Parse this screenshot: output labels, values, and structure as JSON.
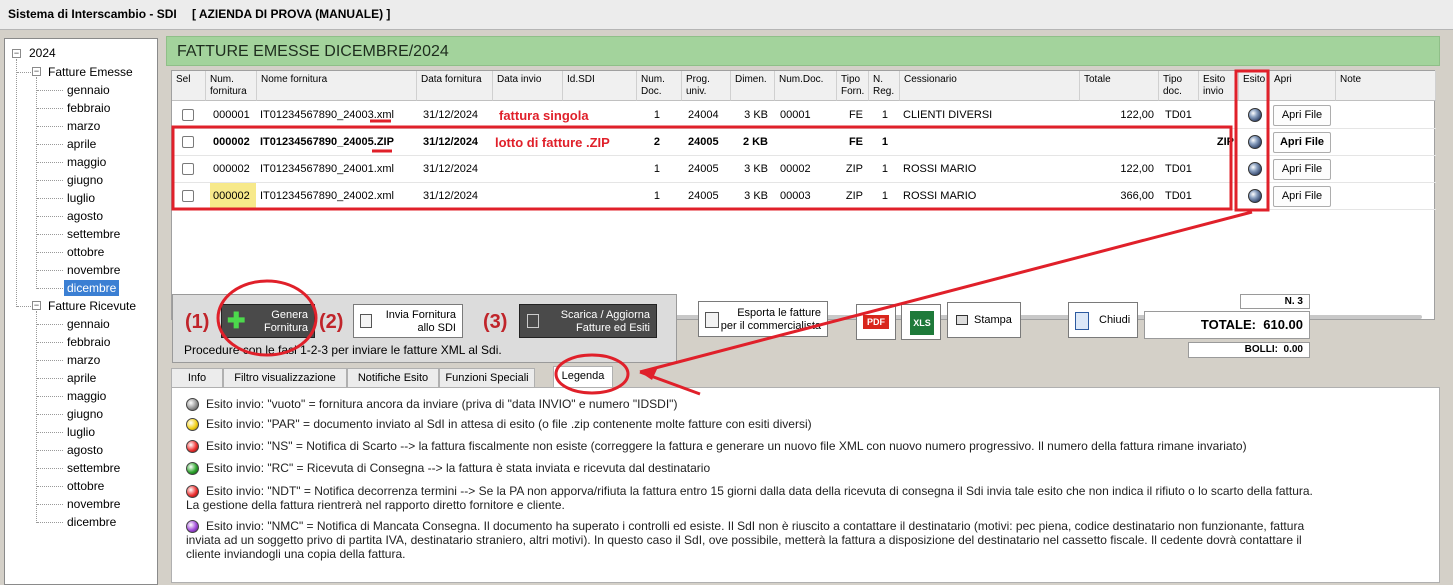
{
  "app": {
    "title": "Sistema di Interscambio - SDI",
    "company": "[ AZIENDA DI PROVA (MANUALE) ]"
  },
  "tree": {
    "year": "2024",
    "emesse": "Fatture Emesse",
    "ricevute": "Fatture Ricevute",
    "months": [
      "gennaio",
      "febbraio",
      "marzo",
      "aprile",
      "maggio",
      "giugno",
      "luglio",
      "agosto",
      "settembre",
      "ottobre",
      "novembre",
      "dicembre"
    ],
    "selected_month": "dicembre",
    "expand_symbol": "−"
  },
  "header": {
    "title": "FATTURE EMESSE DICEMBRE/2024"
  },
  "grid": {
    "columns": {
      "sel": "Sel",
      "num_fornitura": "Num. fornitura",
      "nome_fornitura": "Nome fornitura",
      "data_fornitura": "Data fornitura",
      "data_invio": "Data invio",
      "id_sdi": "Id.SDI",
      "num_doc": "Num. Doc.",
      "prog_univ": "Prog. univ.",
      "dimen": "Dimen.",
      "num_doc2": "Num.Doc.",
      "tipo_forn": "Tipo Forn.",
      "n_reg": "N. Reg.",
      "cessionario": "Cessionario",
      "totale": "Totale",
      "tipo_doc": "Tipo doc.",
      "esito_invio": "Esito invio",
      "esito": "Esito",
      "apri": "Apri",
      "note": "Note"
    },
    "rows": [
      {
        "num_fornitura": "000001",
        "nome_fornitura": "IT01234567890_24003.xml",
        "data_fornitura": "31/12/2024",
        "num_doc": "1",
        "prog_univ": "24004",
        "dimen": "3 KB",
        "num_doc2": "00001",
        "tipo_forn": "FE",
        "n_reg": "1",
        "cessionario": "CLIENTI DIVERSI",
        "totale": "122,00",
        "tipo_doc": "TD01",
        "esito_invio": "",
        "apri": "Apri File"
      },
      {
        "num_fornitura": "000002",
        "nome_fornitura": "IT01234567890_24005.ZIP",
        "data_fornitura": "31/12/2024",
        "num_doc": "2",
        "prog_univ": "24005",
        "dimen": "2 KB",
        "num_doc2": "",
        "tipo_forn": "FE",
        "n_reg": "1",
        "cessionario": "",
        "totale": "",
        "tipo_doc": "",
        "esito_invio": "ZIP",
        "apri": "Apri File"
      },
      {
        "num_fornitura": "000002",
        "nome_fornitura": "IT01234567890_24001.xml",
        "data_fornitura": "31/12/2024",
        "num_doc": "1",
        "prog_univ": "24005",
        "dimen": "3 KB",
        "num_doc2": "00002",
        "tipo_forn": "ZIP",
        "n_reg": "1",
        "cessionario": "ROSSI MARIO",
        "totale": "122,00",
        "tipo_doc": "TD01",
        "esito_invio": "",
        "apri": "Apri File"
      },
      {
        "num_fornitura": "000002",
        "nome_fornitura": "IT01234567890_24002.xml",
        "data_fornitura": "31/12/2024",
        "num_doc": "1",
        "prog_univ": "24005",
        "dimen": "3 KB",
        "num_doc2": "00003",
        "tipo_forn": "ZIP",
        "n_reg": "1",
        "cessionario": "ROSSI MARIO",
        "totale": "366,00",
        "tipo_doc": "TD01",
        "esito_invio": "",
        "apri": "Apri File"
      }
    ],
    "notes": {
      "single": "fattura singola",
      "zip": "lotto di  fatture .ZIP"
    }
  },
  "actions": {
    "step1": "(1)",
    "step2": "(2)",
    "step3": "(3)",
    "genera_l1": "Genera",
    "genera_l2": "Fornitura",
    "invia_l1": "Invia Fornitura",
    "invia_l2": "allo SDI",
    "scarica_l1": "Scarica / Aggiorna",
    "scarica_l2": "Fatture ed Esiti",
    "procedure_text": "Procedure con le fasi 1-2-3 per inviare le fatture XML al Sdi.",
    "esporta_l1": "Esporta le fatture",
    "esporta_l2": "per il commercialista",
    "pdf": "PDF",
    "xls": "XLS",
    "stampa": "Stampa",
    "chiudi": "Chiudi"
  },
  "totals": {
    "n_label": "N. 3",
    "totale_label": "TOTALE:",
    "totale_value": "610.00",
    "bolli_label": "BOLLI:",
    "bolli_value": "0.00"
  },
  "tabs": [
    "Info",
    "Filtro visualizzazione",
    "Notifiche Esito",
    "Funzioni Speciali",
    "Legenda"
  ],
  "legend": [
    {
      "color": "grey",
      "text": "Esito invio: \"vuoto\" = fornitura ancora da inviare (priva di \"data INVIO\" e numero \"IDSDI\")"
    },
    {
      "color": "yellow",
      "text": "Esito invio: \"PAR\" = documento inviato al SdI in attesa di esito (o file .zip contenente molte fatture con esiti diversi)"
    },
    {
      "color": "red",
      "text": "Esito invio: \"NS\" = Notifica di Scarto --> la fattura fiscalmente non esiste (correggere la fattura e generare un nuovo file XML con nuovo numero progressivo. Il numero della fattura rimane invariato)"
    },
    {
      "color": "green",
      "text": "Esito invio: \"RC\" = Ricevuta di Consegna --> la fattura è stata inviata e ricevuta dal destinatario"
    },
    {
      "color": "red",
      "text": "Esito invio: \"NDT\" = Notifica decorrenza termini --> Se la PA non apporva/rifiuta la fattura entro 15 giorni dalla data della ricevuta di consegna  il Sdi invia tale esito che non indica il rifiuto o lo scarto della fattura. La gestione della fattura rientrerà nel rapporto diretto fornitore e cliente."
    },
    {
      "color": "purple",
      "text": "Esito invio: \"NMC\" = Notifica di Mancata Consegna. Il documento ha superato i controlli ed esiste. Il SdI non è riuscito a  contattare il destinatario (motivi: pec piena, codice destinatario non funzionante, fattura inviata ad un soggetto privo di partita IVA, destinatario straniero, altri motivi). In questo caso il SdI, ove possibile, metterà la fattura a disposizione del destinatario nel cassetto fiscale. Il cedente dovrà contattare il cliente inviandogli una copia della fattura."
    }
  ]
}
